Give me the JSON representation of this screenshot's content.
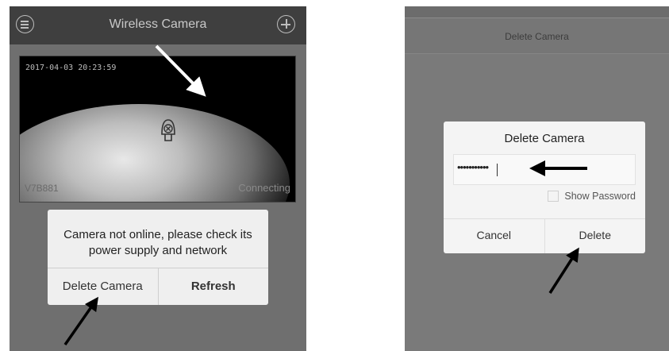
{
  "left_screen": {
    "header": {
      "title": "Wireless Camera",
      "menu_icon": "menu-icon",
      "add_icon": "add-icon"
    },
    "video": {
      "timestamp": "2017-04-03 20:23:59",
      "camera_id": "V7B881",
      "status": "Connecting",
      "placeholder_icon": "camera-offline-icon"
    },
    "dialog": {
      "message": "Camera not online, please check its power supply and network",
      "buttons": {
        "delete": "Delete Camera",
        "refresh": "Refresh"
      }
    }
  },
  "right_screen": {
    "header": {
      "title": "Delete Camera"
    },
    "dialog": {
      "title": "Delete Camera",
      "password_value": "•••••••••••",
      "show_password_label": "Show Password",
      "show_password_checked": false,
      "buttons": {
        "cancel": "Cancel",
        "delete": "Delete"
      }
    }
  },
  "colors": {
    "dialog_bg": "#efefef",
    "header_bg": "#3f3f3f",
    "overlay": "#6f6f6f"
  }
}
